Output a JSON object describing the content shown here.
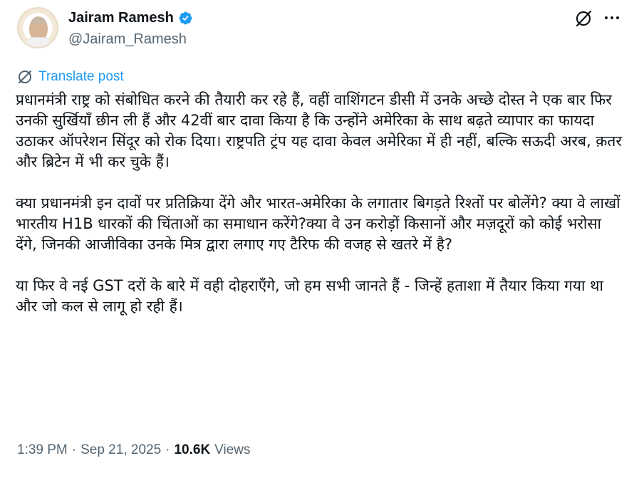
{
  "author": {
    "display_name": "Jairam Ramesh",
    "handle": "@Jairam_Ramesh",
    "verified": true,
    "verified_color": "#1d9bf0",
    "avatar_icon": "profile-photo"
  },
  "actions": {
    "grok_icon": "grok-slash-circle-icon",
    "more_icon": "more-dots-icon"
  },
  "translate": {
    "label": "Translate post",
    "icon": "globe-translate-icon",
    "color": "#1d9bf0"
  },
  "post": {
    "paragraphs": [
      "प्रधानमंत्री राष्ट्र को संबोधित करने की तैयारी कर रहे हैं, वहीं वाशिंगटन डीसी में उनके अच्छे दोस्त ने एक बार फिर उनकी सुर्खियाँ छीन ली हैं और 42वीं बार दावा किया है कि उन्होंने अमेरिका के साथ बढ़ते व्यापार का फायदा उठाकर ऑपरेशन सिंदूर को रोक दिया। राष्ट्रपति ट्रंप यह दावा केवल अमेरिका में ही नहीं, बल्कि सऊदी अरब, क़तर और ब्रिटेन में भी कर चुके हैं।",
      "क्या प्रधानमंत्री इन दावों पर प्रतिक्रिया देंगे और भारत-अमेरिका के लगातार बिगड़ते रिश्तों पर बोलेंगे? क्या वे लाखों भारतीय H1B धारकों की चिंताओं का समाधान करेंगे?क्या वे उन करोड़ों किसानों और मज़दूरों को कोई भरोसा देंगे, जिनकी आजीविका उनके मित्र द्वारा लगाए गए टैरिफ की वजह से खतरे में है?",
      "या फिर वे नई GST दरों के बारे में वही दोहराएँगे, जो हम सभी जानते हैं - जिन्हें हताशा में तैयार किया गया था और जो कल से लागू हो रही हैं।"
    ]
  },
  "meta": {
    "time": "1:39 PM",
    "separator": "·",
    "date": "Sep 21, 2025",
    "views_count": "10.6K",
    "views_label": "Views"
  }
}
